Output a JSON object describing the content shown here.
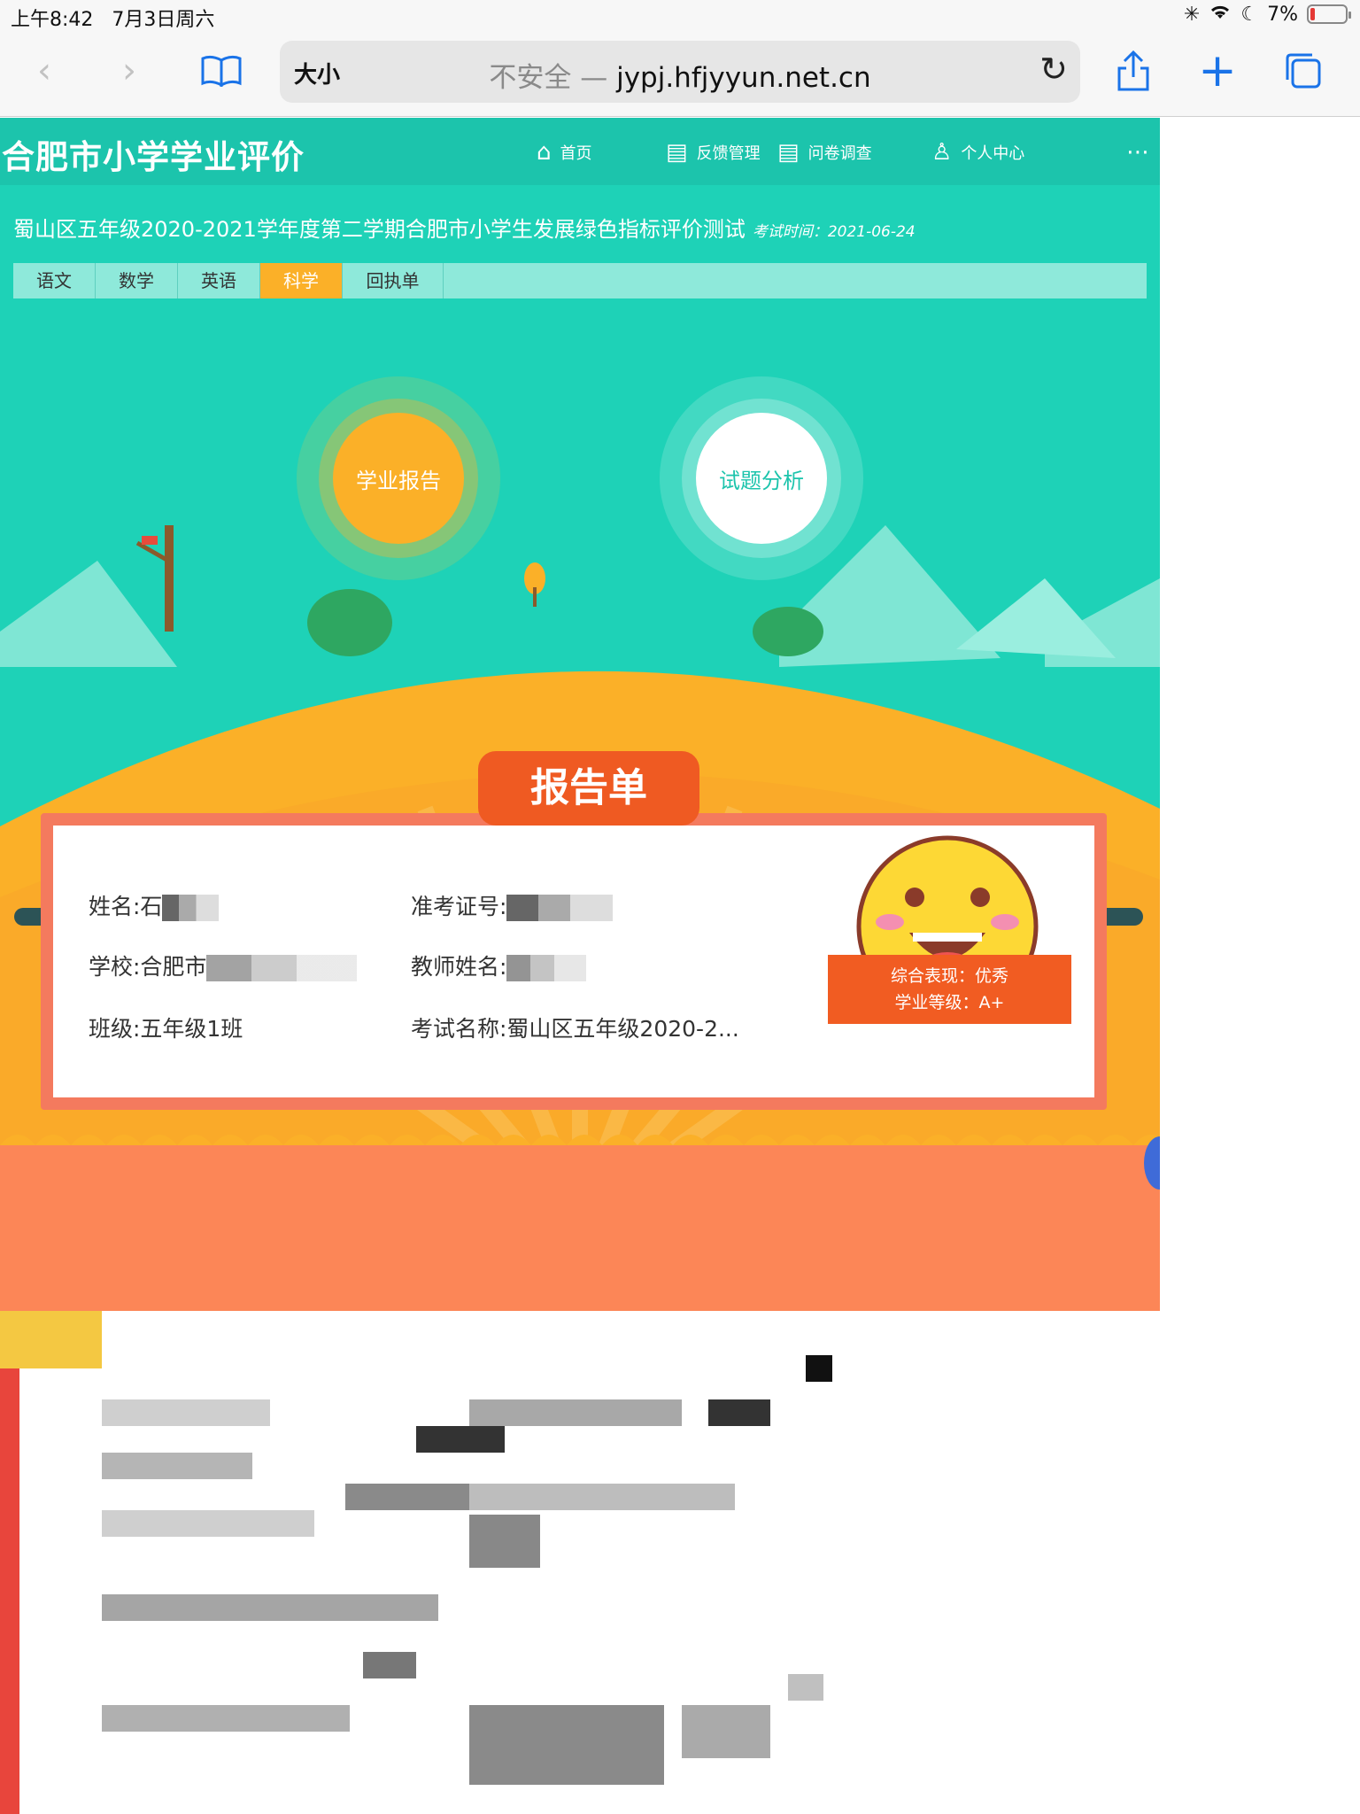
{
  "status_bar": {
    "time": "上午8:42",
    "date": "7月3日周六",
    "battery_percent": "7%"
  },
  "browser": {
    "reader_label": "大小",
    "insecure_label": "不安全 —",
    "domain": "jypj.hfjyyun.net.cn"
  },
  "site": {
    "logo": "合肥市小学学业评价",
    "nav": [
      {
        "label": "首页"
      },
      {
        "label": "反馈管理"
      },
      {
        "label": "问卷调查"
      },
      {
        "label": "个人中心"
      }
    ]
  },
  "exam": {
    "title": "蜀山区五年级2020-2021学年度第二学期合肥市小学生发展绿色指标评价测试",
    "date_label": "考试时间：2021-06-24"
  },
  "subject_tabs": [
    {
      "label": "语文"
    },
    {
      "label": "数学"
    },
    {
      "label": "英语"
    },
    {
      "label": "科学"
    },
    {
      "label": "回执单"
    }
  ],
  "active_subject": "科学",
  "circles": {
    "report": "学业报告",
    "analysis": "试题分析"
  },
  "report_card": {
    "title": "报告单",
    "name_label": "姓名:石",
    "ticket_label": "准考证号:",
    "school_label": "学校:合肥市",
    "teacher_label": "教师姓名:",
    "class_label": "班级:五年级1班",
    "exam_name_label": "考试名称:蜀山区五年级2020-2...",
    "overall_label": "综合表现：优秀",
    "grade_label": "学业等级：A+"
  },
  "colors": {
    "teal": "#1ed2b7",
    "orange": "#fbb028",
    "red_orange": "#f15c22",
    "coral": "#f47a5e"
  }
}
